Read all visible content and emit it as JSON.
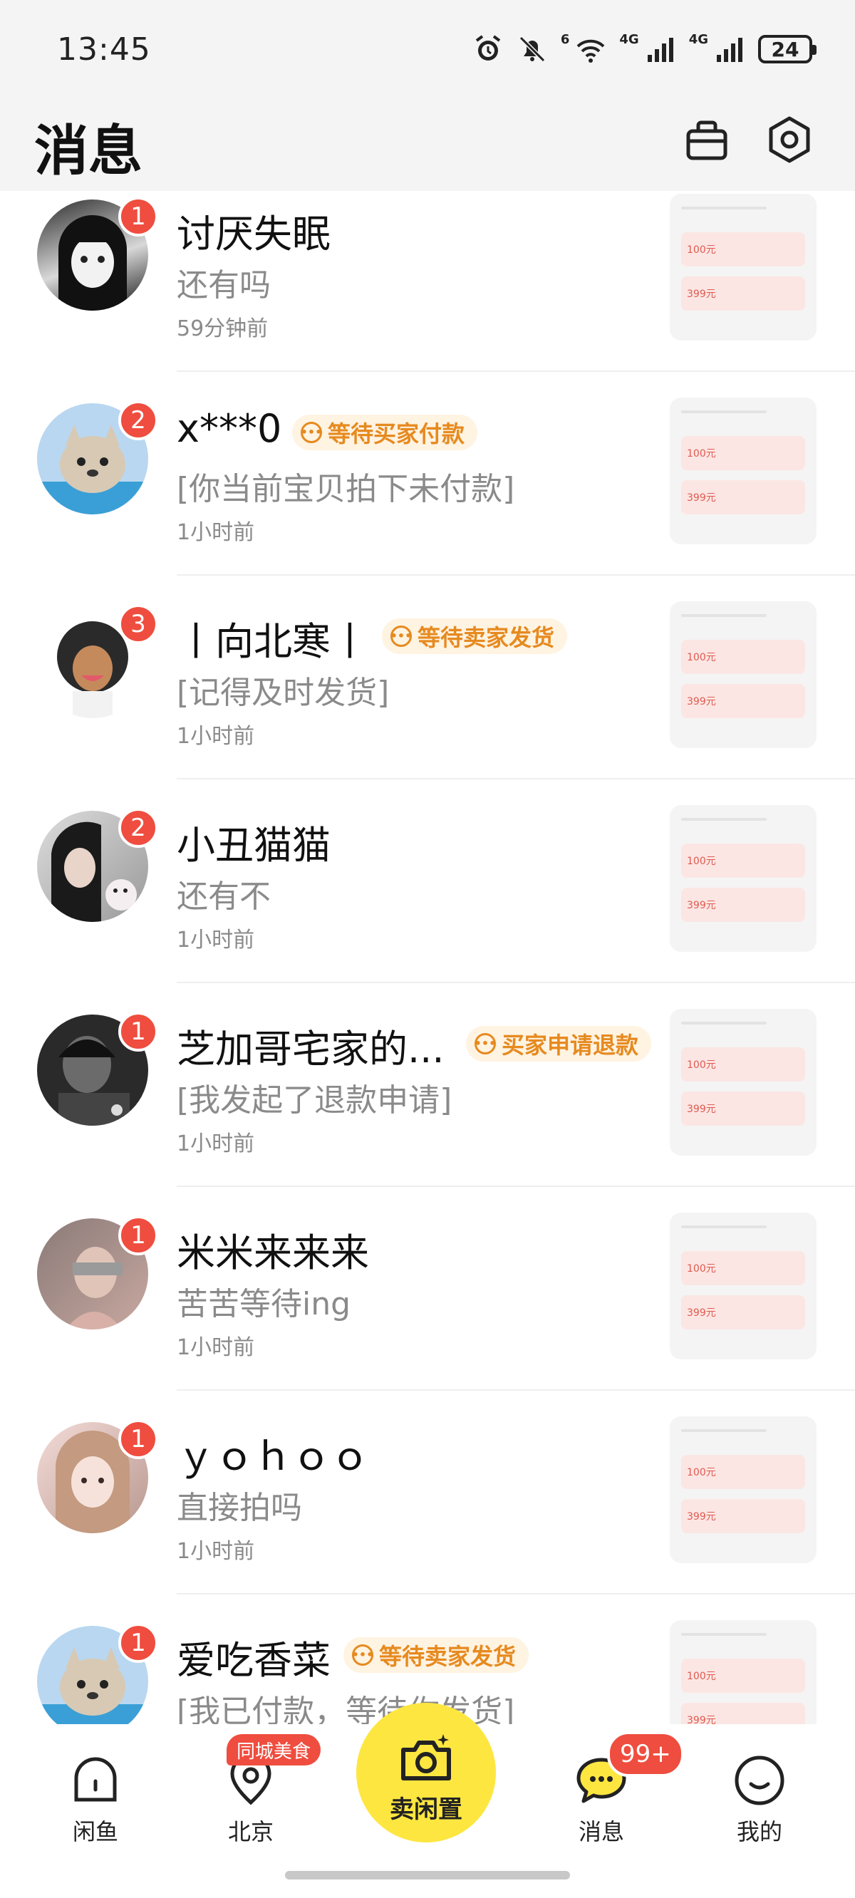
{
  "status_bar": {
    "time": "13:45",
    "net1": "4G",
    "net2": "4G",
    "wifi_tag": "6",
    "battery": "24",
    "icons": [
      "alarm-icon",
      "bell-off-icon",
      "wifi-icon",
      "signal-icon",
      "signal-icon",
      "battery-icon"
    ]
  },
  "header": {
    "title": "消息",
    "icons": [
      "bag-icon",
      "settings-icon"
    ]
  },
  "conversations": [
    {
      "name": "讨厌失眠",
      "badge": "1",
      "tag": "",
      "message": "还有吗",
      "time": "59分钟前"
    },
    {
      "name": "x***0",
      "badge": "2",
      "tag": "等待买家付款",
      "message": "[你当前宝贝拍下未付款]",
      "time": "1小时前"
    },
    {
      "name": "丨向北寒丨",
      "badge": "3",
      "tag": "等待卖家发货",
      "message": "[记得及时发货]",
      "time": "1小时前"
    },
    {
      "name": "小丑猫猫",
      "badge": "2",
      "tag": "",
      "message": "还有不",
      "time": "1小时前"
    },
    {
      "name": "芝加哥宅家的...",
      "badge": "1",
      "tag": "买家申请退款",
      "message": "[我发起了退款申请]",
      "time": "1小时前"
    },
    {
      "name": "米米来来来",
      "badge": "1",
      "tag": "",
      "message": "苦苦等待ing",
      "time": "1小时前"
    },
    {
      "name": "ｙｏｈｏｏ",
      "badge": "1",
      "tag": "",
      "message": "直接拍吗",
      "time": "1小时前"
    },
    {
      "name": "爱吃香菜",
      "badge": "1",
      "tag": "等待卖家发货",
      "message": "[我已付款，等待你发货]",
      "time": ""
    }
  ],
  "thumbnail": {
    "price1": "100元",
    "price2": "399元"
  },
  "bottom_nav": {
    "home": "闲鱼",
    "city": "北京",
    "city_badge": "同城美食",
    "sell": "卖闲置",
    "messages": "消息",
    "messages_badge": "99+",
    "me": "我的"
  },
  "colors": {
    "accent": "#fde640",
    "badge": "#ef4d3f",
    "tag_text": "#e68a1f",
    "tag_bg": "#fff3e2"
  }
}
